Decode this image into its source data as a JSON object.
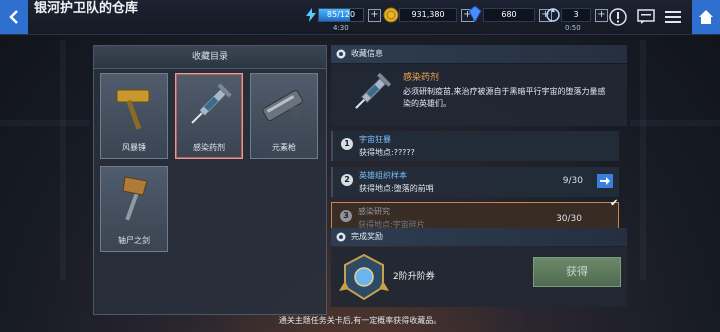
{
  "header": {
    "title": "银河护卫队的仓库",
    "energy": {
      "text": "85/120",
      "fraction": 0.708,
      "timer": "4:30"
    },
    "gold": {
      "value": "931,380"
    },
    "crystal": {
      "value": "680"
    },
    "stamina": {
      "value": "3",
      "timer": "0:50"
    }
  },
  "collection": {
    "heading": "收藏目录",
    "items": [
      {
        "label": "风暴锤",
        "icon": "hammer-icon"
      },
      {
        "label": "感染药剂",
        "icon": "syringe-icon"
      },
      {
        "label": "元素枪",
        "icon": "gun-icon"
      },
      {
        "label": "轴尸之剑",
        "icon": "axe-icon"
      }
    ]
  },
  "info": {
    "heading": "收藏信息",
    "item_name": "感染药剂",
    "description": "必须研制疫苗,来治疗被源自于黑暗平行宇宙的堕落力量感染的英雄们。"
  },
  "quests": [
    {
      "num": "1",
      "title": "宇宙狂暴",
      "location": "获得地点:?????"
    },
    {
      "num": "2",
      "title": "英雄组织样本",
      "location": "获得地点:堕落的前哨",
      "progress": "9/30"
    },
    {
      "num": "3",
      "title": "感染研究",
      "location": "获得地点:宇宙碎片",
      "progress": "30/30"
    }
  ],
  "reward": {
    "heading": "完成奖励",
    "name": "2阶升阶券",
    "button": "获得"
  },
  "footer": "通关主题任务关卡后,有一定概率获得收藏品。",
  "colors": {
    "accent_blue": "#2e6fd0",
    "item_name_orange": "#f0a64a",
    "quest_title_blue": "#7cc2ff"
  }
}
